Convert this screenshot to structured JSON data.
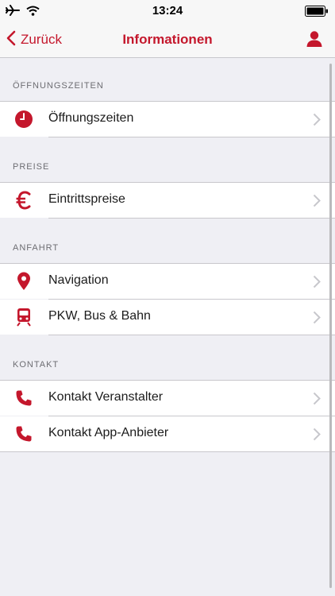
{
  "statusbar": {
    "time": "13:24"
  },
  "navbar": {
    "back_label": "Zurück",
    "title": "Informationen"
  },
  "accent_color": "#c4172c",
  "sections": [
    {
      "header": "ÖFFNUNGSZEITEN",
      "items": [
        {
          "label": "Öffnungszeiten",
          "icon": "clock-icon"
        }
      ]
    },
    {
      "header": "PREISE",
      "items": [
        {
          "label": "Eintrittspreise",
          "icon": "euro-icon"
        }
      ]
    },
    {
      "header": "ANFAHRT",
      "items": [
        {
          "label": "Navigation",
          "icon": "location-pin-icon"
        },
        {
          "label": "PKW, Bus & Bahn",
          "icon": "train-icon"
        }
      ]
    },
    {
      "header": "KONTAKT",
      "items": [
        {
          "label": "Kontakt Veranstalter",
          "icon": "phone-icon"
        },
        {
          "label": "Kontakt App-Anbieter",
          "icon": "phone-icon"
        }
      ]
    }
  ]
}
